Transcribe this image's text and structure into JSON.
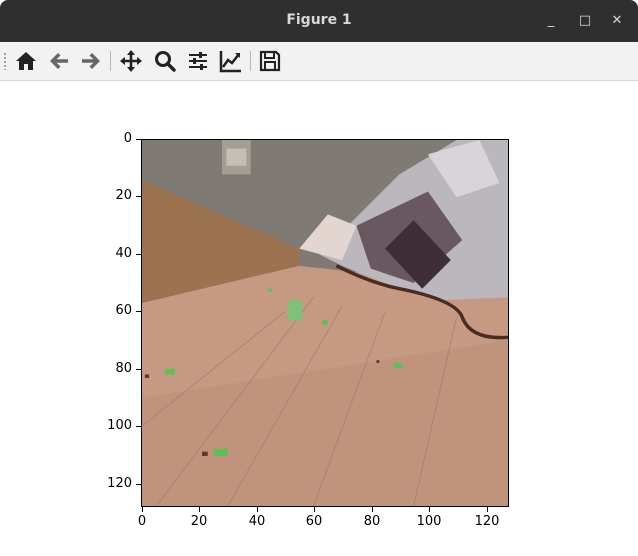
{
  "window": {
    "title": "Figure 1",
    "minimize": "_",
    "maximize": "□",
    "close": "✕"
  },
  "toolbar": {
    "buttons": [
      {
        "name": "home",
        "icon": "home-icon"
      },
      {
        "name": "back",
        "icon": "back-arrow-icon"
      },
      {
        "name": "forward",
        "icon": "forward-arrow-icon"
      },
      {
        "name": "pan",
        "icon": "move-icon"
      },
      {
        "name": "zoom",
        "icon": "zoom-icon"
      },
      {
        "name": "subplots",
        "icon": "sliders-icon"
      },
      {
        "name": "axes",
        "icon": "line-chart-icon"
      },
      {
        "name": "save",
        "icon": "save-icon"
      }
    ]
  },
  "plot": {
    "y_ticks": [
      "0",
      "20",
      "40",
      "60",
      "80",
      "100",
      "120"
    ],
    "x_ticks": [
      "0",
      "20",
      "40",
      "60",
      "80",
      "100",
      "120"
    ]
  }
}
